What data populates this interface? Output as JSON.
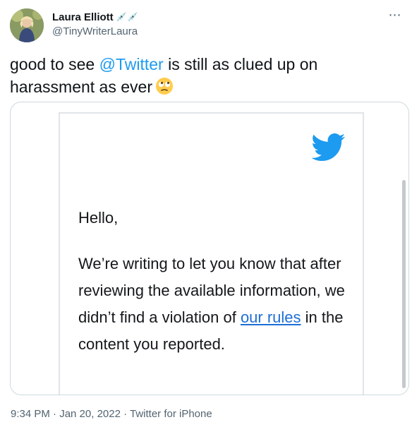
{
  "author": {
    "display_name": "Laura Elliott",
    "name_emoji": "💉💉",
    "handle": "@TinyWriterLaura"
  },
  "more_icon": "⋯",
  "tweet": {
    "text_prefix": "good to see ",
    "mention": "@Twitter",
    "text_suffix": " is still as clued up on harassment as ever",
    "emoji_name": "face-with-rolling-eyes"
  },
  "email_screenshot": {
    "logo": "twitter-bird",
    "greeting": "Hello,",
    "body_before_link": "We’re writing to let you know that after reviewing the available information, we didn’t find a violation of ",
    "link_text": "our rules",
    "body_after_link": " in the content you reported."
  },
  "meta": {
    "timestamp": "9:34 PM · Jan 20, 2022 · Twitter for iPhone"
  },
  "colors": {
    "accent": "#1d9bf0",
    "secondary_text": "#536471",
    "email_link": "#1d6fd6"
  }
}
